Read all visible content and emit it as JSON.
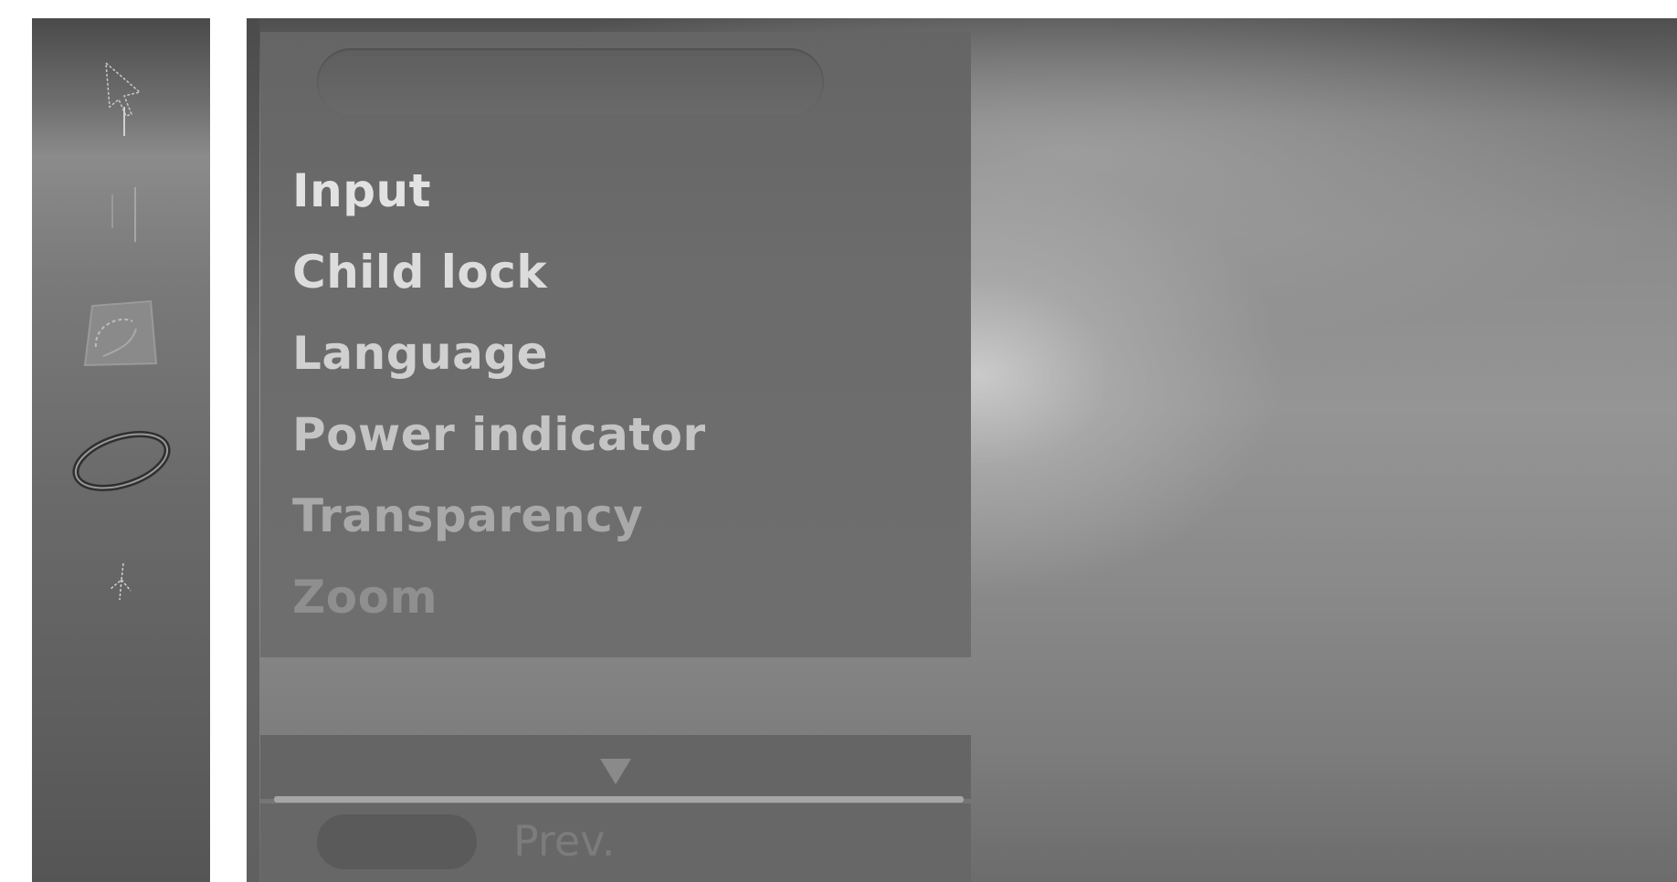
{
  "sidebar": {
    "icons": [
      {
        "name": "setup-cursor-icon"
      },
      {
        "name": "picture-icon"
      },
      {
        "name": "sound-icon"
      },
      {
        "name": "time-icon"
      },
      {
        "name": "option-icon"
      }
    ]
  },
  "menu": {
    "title": "",
    "items": [
      {
        "label": "Input",
        "color": "#e2e2e2"
      },
      {
        "label": "Child lock",
        "color": "#dcdcdc"
      },
      {
        "label": "Language",
        "color": "#d0d0d0"
      },
      {
        "label": "Power indicator",
        "color": "#c4c4c4"
      },
      {
        "label": "Transparency",
        "color": "#a9a9a9"
      },
      {
        "label": "Zoom",
        "color": "#8f8f8f"
      }
    ]
  },
  "footer": {
    "scroll_arrow": "down-arrow",
    "prev_label": "Prev."
  },
  "colors": {
    "menu_panel": "#6b6b6b",
    "divider": "#a6a6a6"
  }
}
